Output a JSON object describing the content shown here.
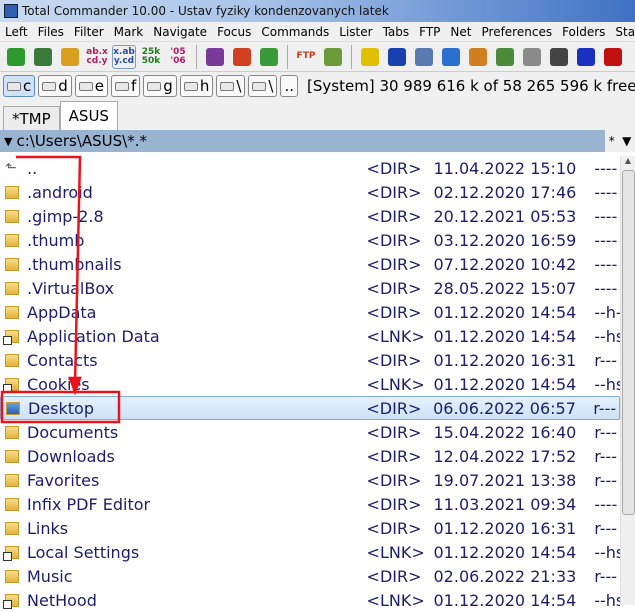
{
  "window": {
    "title": "Total Commander 10.00 - Ustav fyziky kondenzovanych latek"
  },
  "menu": [
    "Left",
    "Files",
    "Filter",
    "Mark",
    "Navigate",
    "Focus",
    "Commands",
    "Lister",
    "Tabs",
    "FTP",
    "Net",
    "Preferences",
    "Folders",
    "Start"
  ],
  "toolbar": {
    "buttons": [
      {
        "icon": "refresh-icon",
        "label": ""
      },
      {
        "icon": "thumbnails-icon",
        "label": ""
      },
      {
        "icon": "tree-icon",
        "label": ""
      },
      {
        "icon": "rename-icon",
        "label": "ab.x cd.y"
      },
      {
        "icon": "sort-extension-icon",
        "label": "x.ab y.cd"
      },
      {
        "icon": "size-icon",
        "label": "25k 50k"
      },
      {
        "icon": "date-icon",
        "label": "'05 '06"
      },
      {
        "icon": "archive-icon",
        "label": ""
      },
      {
        "icon": "pack-icon",
        "label": ""
      },
      {
        "icon": "unpack-icon",
        "label": ""
      },
      {
        "icon": "ftp-icon",
        "label": "FTP"
      },
      {
        "icon": "clipboard-icon",
        "label": ""
      },
      {
        "icon": "warning-icon",
        "label": ""
      },
      {
        "icon": "save-icon",
        "label": ""
      },
      {
        "icon": "network-icon",
        "label": ""
      },
      {
        "icon": "card-icon",
        "label": ""
      },
      {
        "icon": "windows-icon",
        "label": ""
      },
      {
        "icon": "editor-icon",
        "label": ""
      },
      {
        "icon": "usb-icon",
        "label": ""
      },
      {
        "icon": "usb-stick-icon",
        "label": ""
      },
      {
        "icon": "monitor-icon",
        "label": ""
      },
      {
        "icon": "record-icon",
        "label": ""
      }
    ]
  },
  "drives": {
    "items": [
      "c",
      "d",
      "e",
      "f",
      "g",
      "h",
      "\\",
      "\\",
      ".."
    ],
    "active": "c",
    "label": "[System]",
    "free": "30 989 616 k of 58 265 596 k free"
  },
  "tabs": [
    {
      "label": "*TMP",
      "active": false
    },
    {
      "label": "ASUS",
      "active": true
    }
  ],
  "path": {
    "value": "c:\\Users\\ASUS\\*.*",
    "filter": "*"
  },
  "files": [
    {
      "name": "..",
      "type": "<DIR>",
      "date": "11.04.2022 15:10",
      "attr": "----",
      "icon": "up"
    },
    {
      "name": ".android",
      "type": "<DIR>",
      "date": "02.12.2020 17:46",
      "attr": "----"
    },
    {
      "name": ".gimp-2.8",
      "type": "<DIR>",
      "date": "20.12.2021 05:53",
      "attr": "----"
    },
    {
      "name": ".thumb",
      "type": "<DIR>",
      "date": "03.12.2020 16:59",
      "attr": "----"
    },
    {
      "name": ".thumbnails",
      "type": "<DIR>",
      "date": "07.12.2020 10:42",
      "attr": "----"
    },
    {
      "name": ".VirtualBox",
      "type": "<DIR>",
      "date": "28.05.2022 15:07",
      "attr": "----"
    },
    {
      "name": "AppData",
      "type": "<DIR>",
      "date": "01.12.2020 14:54",
      "attr": "--h-"
    },
    {
      "name": "Application Data",
      "type": "<LNK>",
      "date": "01.12.2020 14:54",
      "attr": "--hs",
      "icon": "lnk"
    },
    {
      "name": "Contacts",
      "type": "<DIR>",
      "date": "01.12.2020 16:31",
      "attr": "r---"
    },
    {
      "name": "Cookies",
      "type": "<LNK>",
      "date": "01.12.2020 14:54",
      "attr": "--hs",
      "icon": "lnk"
    },
    {
      "name": "Desktop",
      "type": "<DIR>",
      "date": "06.06.2022 06:57",
      "attr": "r---",
      "selected": true
    },
    {
      "name": "Documents",
      "type": "<DIR>",
      "date": "15.04.2022 16:40",
      "attr": "r---"
    },
    {
      "name": "Downloads",
      "type": "<DIR>",
      "date": "12.04.2022 17:52",
      "attr": "r---"
    },
    {
      "name": "Favorites",
      "type": "<DIR>",
      "date": "19.07.2021 13:38",
      "attr": "r---"
    },
    {
      "name": "Infix PDF Editor",
      "type": "<DIR>",
      "date": "11.03.2021 09:34",
      "attr": "----"
    },
    {
      "name": "Links",
      "type": "<DIR>",
      "date": "01.12.2020 16:31",
      "attr": "r---"
    },
    {
      "name": "Local Settings",
      "type": "<LNK>",
      "date": "01.12.2020 14:54",
      "attr": "--hs",
      "icon": "lnk"
    },
    {
      "name": "Music",
      "type": "<DIR>",
      "date": "02.06.2022 21:33",
      "attr": "r---"
    },
    {
      "name": "NetHood",
      "type": "<LNK>",
      "date": "01.12.2020 14:54",
      "attr": "--hs",
      "icon": "lnk"
    }
  ],
  "annotation_color": "#e8141c"
}
